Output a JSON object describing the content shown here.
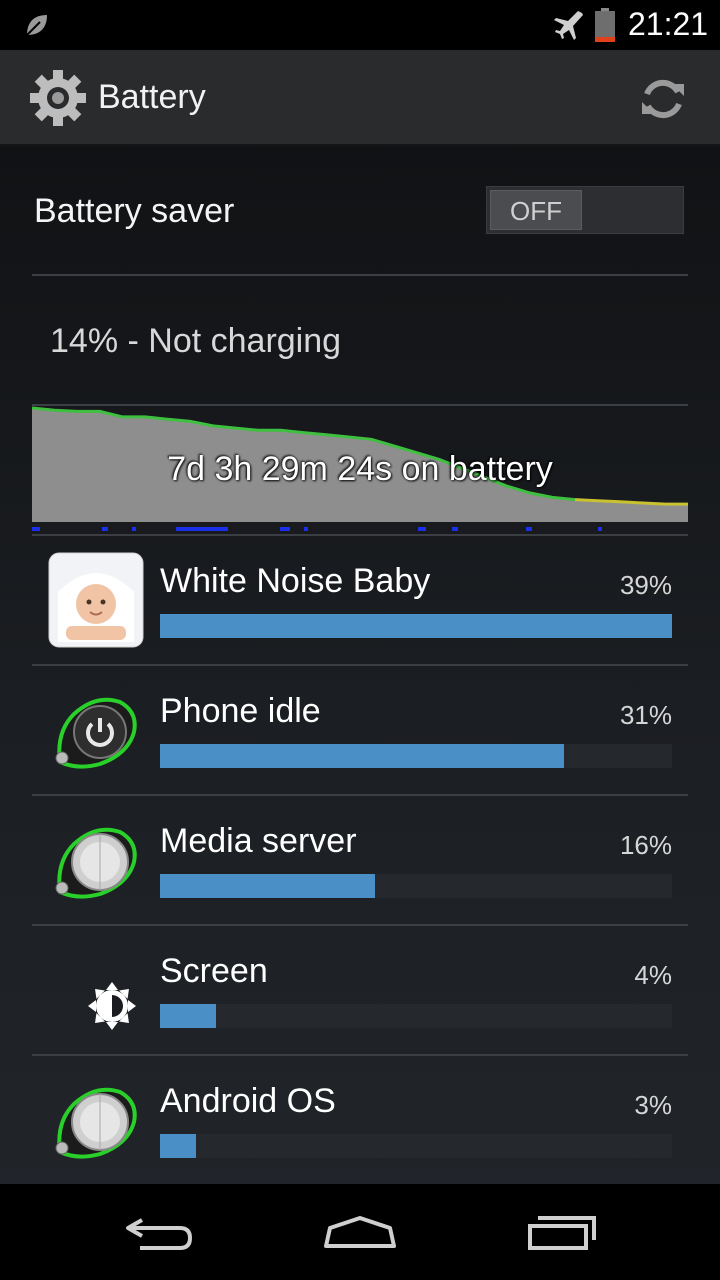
{
  "status_bar": {
    "time": "21:21",
    "icons": [
      "leaf-icon",
      "airplane-mode-icon",
      "battery-low-icon"
    ],
    "battery_level_pct": 14
  },
  "action_bar": {
    "title": "Battery",
    "icons": [
      "settings-gear-icon",
      "refresh-icon"
    ]
  },
  "battery_saver": {
    "label": "Battery saver",
    "toggle_label": "OFF"
  },
  "battery_status": "14% - Not charging",
  "history_graph": {
    "caption": "7d 3h 29m 24s on battery",
    "line_color": "#3fbf3f",
    "end_color": "#c9c130",
    "fill_color": "#8e8e8e",
    "level_points": [
      100,
      98,
      97,
      97,
      92,
      92,
      90,
      88,
      84,
      82,
      80,
      80,
      78,
      76,
      74,
      72,
      66,
      60,
      54,
      46,
      38,
      30,
      24,
      20,
      18,
      17,
      16,
      15,
      14,
      14
    ]
  },
  "apps": [
    {
      "name": "White Noise Baby",
      "percent_label": "39%",
      "bar_fraction": 1.0,
      "icon": "baby-photo-icon"
    },
    {
      "name": "Phone idle",
      "percent_label": "31%",
      "bar_fraction": 0.79,
      "icon": "power-button-icon"
    },
    {
      "name": "Media server",
      "percent_label": "16%",
      "bar_fraction": 0.42,
      "icon": "android-system-icon"
    },
    {
      "name": "Screen",
      "percent_label": "4%",
      "bar_fraction": 0.11,
      "icon": "brightness-icon"
    },
    {
      "name": "Android OS",
      "percent_label": "3%",
      "bar_fraction": 0.07,
      "icon": "android-system-icon"
    }
  ],
  "colors": {
    "accent_bar": "#4a8fc6",
    "background": "#1b1e22"
  },
  "nav_bar": {
    "icons": [
      "back-icon",
      "home-icon",
      "recents-icon"
    ]
  }
}
